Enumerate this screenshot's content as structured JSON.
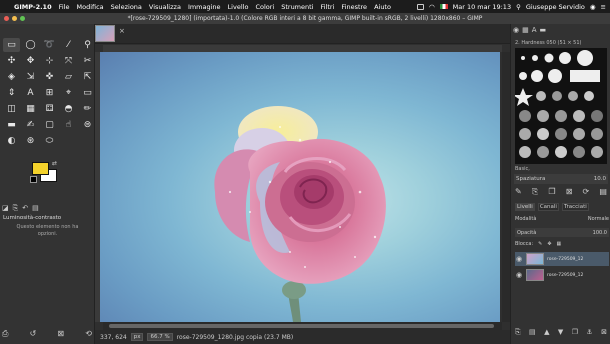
{
  "menubar": {
    "apple": "",
    "app": "GIMP-2.10",
    "items": [
      "File",
      "Modifica",
      "Seleziona",
      "Visualizza",
      "Immagine",
      "Livello",
      "Colori",
      "Strumenti",
      "Filtri",
      "Finestre",
      "Aiuto"
    ],
    "clock": "Mar 10 mar  19:13",
    "user": "Giuseppe Servidio"
  },
  "window": {
    "title": "*[rose-729509_1280] (importata)-1.0 (Colore RGB interi a 8 bit gamma, GIMP built-in sRGB, 2 livelli) 1280x860 – GIMP"
  },
  "toolbox": {
    "tools": [
      "▭",
      "◯",
      "➰",
      "⁄",
      "✣",
      "✥",
      "⊹",
      "⤧",
      "✂",
      "◈",
      "⇲",
      "✜",
      "▱",
      "⇱",
      "⇕",
      "A",
      "⊞",
      "⌖",
      "▭",
      "◫",
      "▦",
      "⚃",
      "◓",
      "✏",
      "▬",
      "✍",
      "▢",
      "☝",
      "⊜",
      "◐",
      "⊛",
      "⬭"
    ],
    "options_tab_title": "Luminosità-contrasto",
    "options_message": "Questo elemento non ha opzioni.",
    "fg_color": "#f4d22b",
    "bg_color": "#ffffff"
  },
  "image": {
    "tab_close": "×",
    "status": {
      "coords": "337, 624",
      "unit": "px",
      "zoom": "66.7 %",
      "layer_info": "rose-729509_1280.jpg copia (23.7 MB)"
    }
  },
  "dock": {
    "brush_name": "2. Hardness 050 (51 × 51)",
    "brush_tag": "Basic,",
    "spacing_label": "Spaziatura",
    "spacing_value": "10.0",
    "layer_tabs": [
      "Livelli",
      "Canali",
      "Tracciati"
    ],
    "mode_label": "Modalità",
    "mode_value": "Normale",
    "opacity_label": "Opacità",
    "opacity_value": "100.0",
    "lock_label": "Blocca:",
    "layers": [
      {
        "name": "rose-729509_12",
        "selected": true
      },
      {
        "name": "rose-729509_12",
        "selected": false
      }
    ]
  },
  "colors": {
    "menubar_bg": "#1c1c1c",
    "titlebar_bg": "#3c3c3c",
    "panel_bg": "#333333",
    "canvas_bg_center": "#bfe3e8",
    "canvas_bg_edge": "#5a7fb0"
  }
}
